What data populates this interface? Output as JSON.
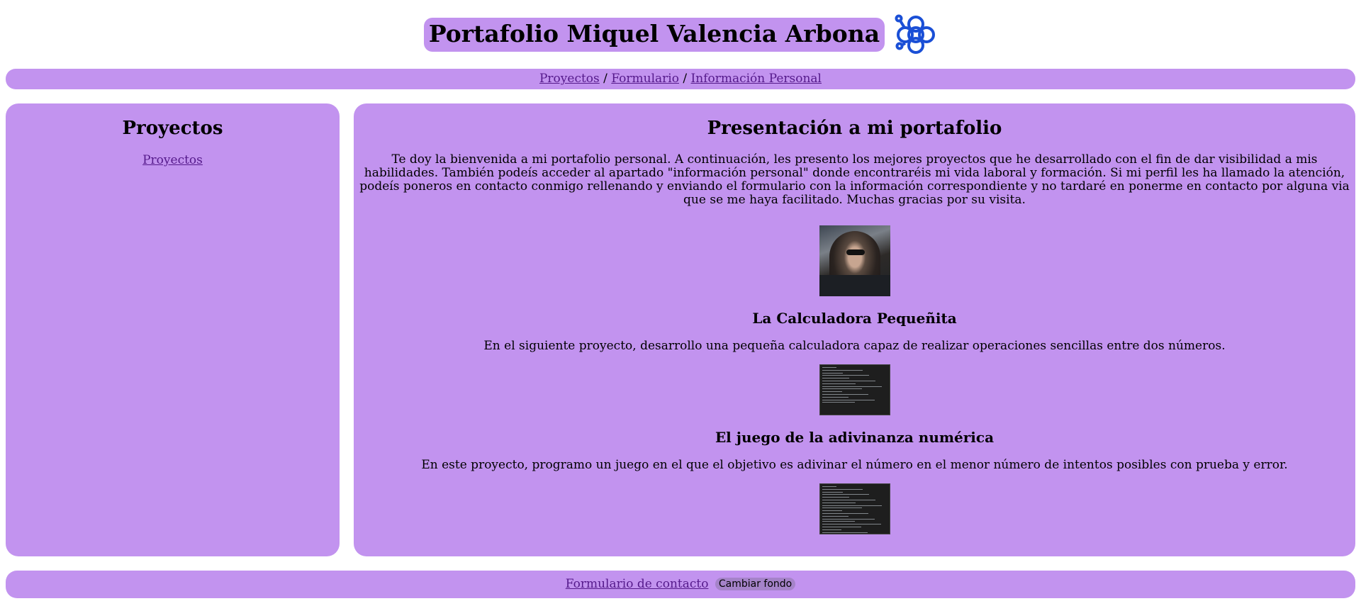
{
  "header": {
    "title": "Portafolio Miquel Valencia Arbona",
    "logo_icon": "flower-logo-icon",
    "logo_color": "#1a4fd6"
  },
  "nav": {
    "items": [
      {
        "label": "Proyectos"
      },
      {
        "label": "Formulario"
      },
      {
        "label": "Información Personal"
      }
    ],
    "separator": "/"
  },
  "sidebar": {
    "heading": "Proyectos",
    "link": "Proyectos"
  },
  "main": {
    "heading": "Presentación a mi portafolio",
    "intro": "Te doy la bienvenida a mi portafolio personal. A continuación, les presento los mejores proyectos que he desarrollado con el fin de dar visibilidad a mis habilidades. También podeís acceder al apartado \"información personal\" donde encontraréis mi vida laboral y formación. Si mi perfil les ha llamado la atención, podeís poneros en contacto conmigo rellenando y enviando el formulario con la información correspondiente y no tardaré en ponerme en contacto por alguna via que se me haya facilitado. Muchas gracias por su visita.",
    "projects": [
      {
        "title": "La Calculadora Pequeñita",
        "description": "En el siguiente proyecto, desarrollo una pequeña calculadora capaz de realizar operaciones sencillas entre dos números."
      },
      {
        "title": "El juego de la adivinanza numérica",
        "description": "En este proyecto, programo un juego en el que el objetivo es adivinar el número en el menor número de intentos posibles con prueba y error."
      }
    ]
  },
  "footer": {
    "contact_link": "Formulario de contacto",
    "bg_button": "Cambiar fondo"
  },
  "colors": {
    "panel": "#c293ef",
    "link": "#551a8b",
    "button": "#a583c9"
  }
}
